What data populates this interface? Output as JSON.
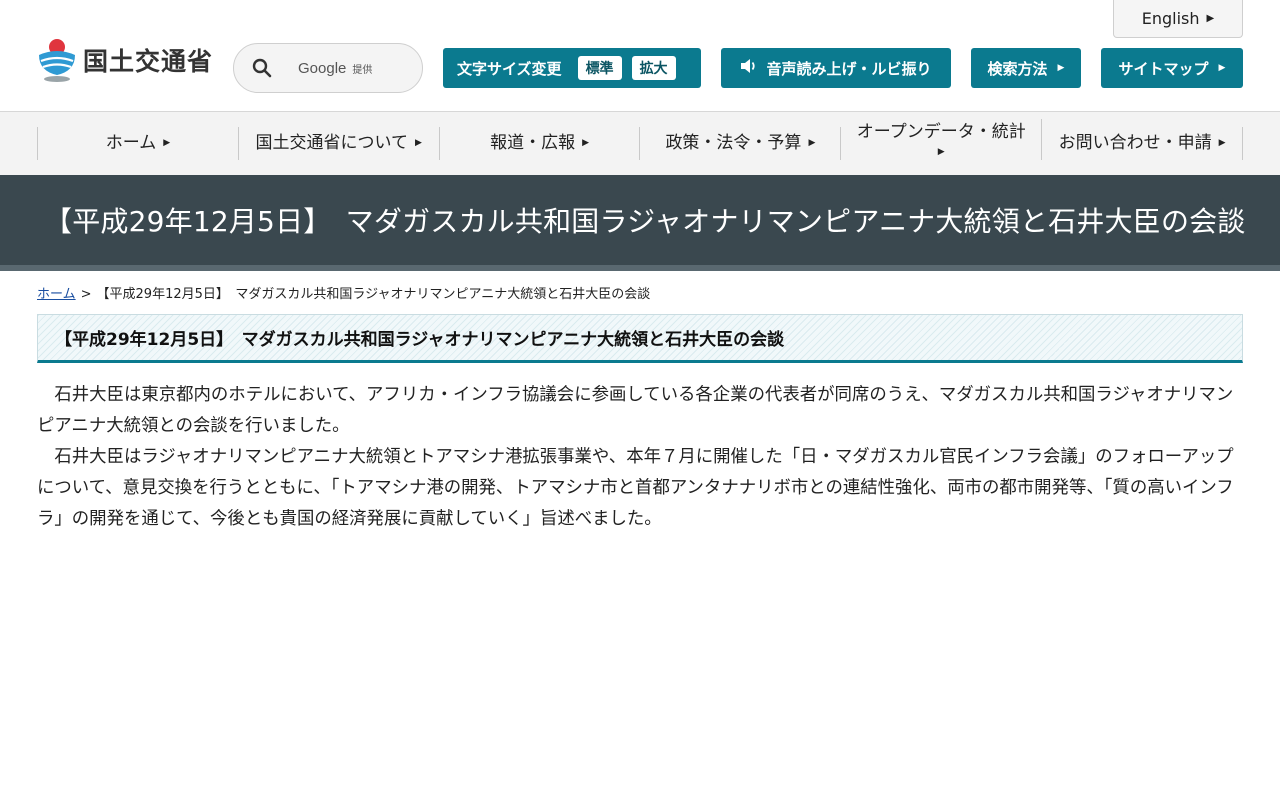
{
  "header": {
    "english_label": "English",
    "logo_text": "国土交通省",
    "search": {
      "google_label": "Google",
      "provided_label": "提供"
    },
    "fontsize": {
      "label": "文字サイズ変更",
      "options": [
        "標準",
        "拡大"
      ]
    },
    "readaloud_label": "音声読み上げ・ルビ振り",
    "search_method_label": "検索方法",
    "sitemap_label": "サイトマップ"
  },
  "nav": {
    "items": [
      {
        "label": "ホーム"
      },
      {
        "label": "国土交通省について"
      },
      {
        "label": "報道・広報"
      },
      {
        "label": "政策・法令・予算"
      },
      {
        "label": "オープンデータ・統計"
      },
      {
        "label": "お問い合わせ・申請"
      }
    ]
  },
  "banner": {
    "title": "【平成29年12月5日】　マダガスカル共和国ラジャオナリマンピアニナ大統領と石井大臣の会談"
  },
  "breadcrumb": {
    "home": "ホーム",
    "separator": ">",
    "current": "【平成29年12月5日】　マダガスカル共和国ラジャオナリマンピアニナ大統領と石井大臣の会談"
  },
  "article": {
    "heading": "【平成29年12月5日】　マダガスカル共和国ラジャオナリマンピアニナ大統領と石井大臣の会談",
    "paragraphs": [
      "石井大臣は東京都内のホテルにおいて、アフリカ・インフラ協議会に参画している各企業の代表者が同席のうえ、マダガスカル共和国ラジャオナリマンピアニナ大統領との会談を行いました。",
      "石井大臣はラジャオナリマンピアニナ大統領とトアマシナ港拡張事業や、本年７月に開催した「日・マダガスカル官民インフラ会議」のフォローアップについて、意見交換を行うとともに、「トアマシナ港の開発、トアマシナ市と首都アンタナナリボ市との連結性強化、両市の都市開発等、「質の高いインフラ」の開発を通じて、今後とも貴国の経済発展に貢献していく」旨述べました。"
    ]
  },
  "colors": {
    "accent": "#0b7a8f",
    "banner_bg": "#3a484f",
    "nav_bg": "#f3f3f3"
  },
  "icons": {
    "logo": "mlit-logo-icon",
    "search": "search-icon",
    "speaker": "speaker-icon",
    "triangle": "triangle-right-icon"
  }
}
